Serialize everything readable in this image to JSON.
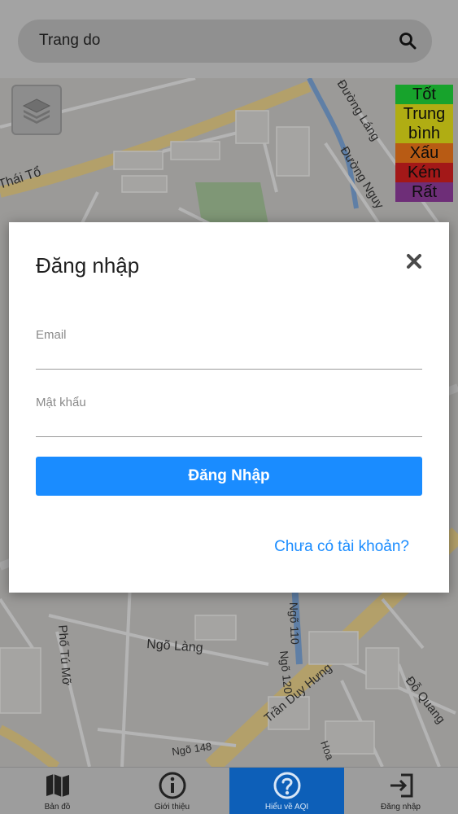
{
  "search": {
    "value": "Trang do",
    "icon": "search-icon"
  },
  "legend": {
    "items": [
      {
        "label": "Tốt",
        "color": "#17a32c"
      },
      {
        "label": "Trung bình",
        "color": "#b0ad13"
      },
      {
        "label": "Xấu",
        "color": "#b85b14"
      },
      {
        "label": "Kém",
        "color": "#a31818"
      },
      {
        "label": "Rất",
        "color": "#6e2e78"
      }
    ]
  },
  "map": {
    "labels": {
      "thai_to": "Thái Tổ",
      "duong_lang": "Đường Láng",
      "duong_nguyen": "Đường Nguy",
      "ngo_lang": "Ngõ Làng",
      "pho_tu_mo": "Phố Tú Mỡ",
      "ngo_110": "Ngõ 110",
      "ngo_120": "Ngõ 120",
      "tran_duy_hung": "Trần Duy Hưng",
      "do_quang": "Đỗ Quang",
      "ngo_148": "Ngõ 148",
      "hoa": "Hoa"
    }
  },
  "login_modal": {
    "title": "Đăng nhập",
    "email_label": "Email",
    "email_value": "",
    "password_label": "Mật khẩu",
    "password_value": "",
    "submit_label": "Đăng Nhập",
    "register_link": "Chưa có tài khoản?"
  },
  "bottom_nav": {
    "items": [
      {
        "label": "Bản đồ",
        "icon": "map-icon",
        "active": false
      },
      {
        "label": "Giới thiệu",
        "icon": "info-icon",
        "active": false
      },
      {
        "label": "Hiểu về AQI",
        "icon": "help-icon",
        "active": true
      },
      {
        "label": "Đăng nhập",
        "icon": "login-icon",
        "active": false
      }
    ]
  },
  "colors": {
    "accent": "#1a8cff",
    "active_tab": "#0d5fb8"
  }
}
